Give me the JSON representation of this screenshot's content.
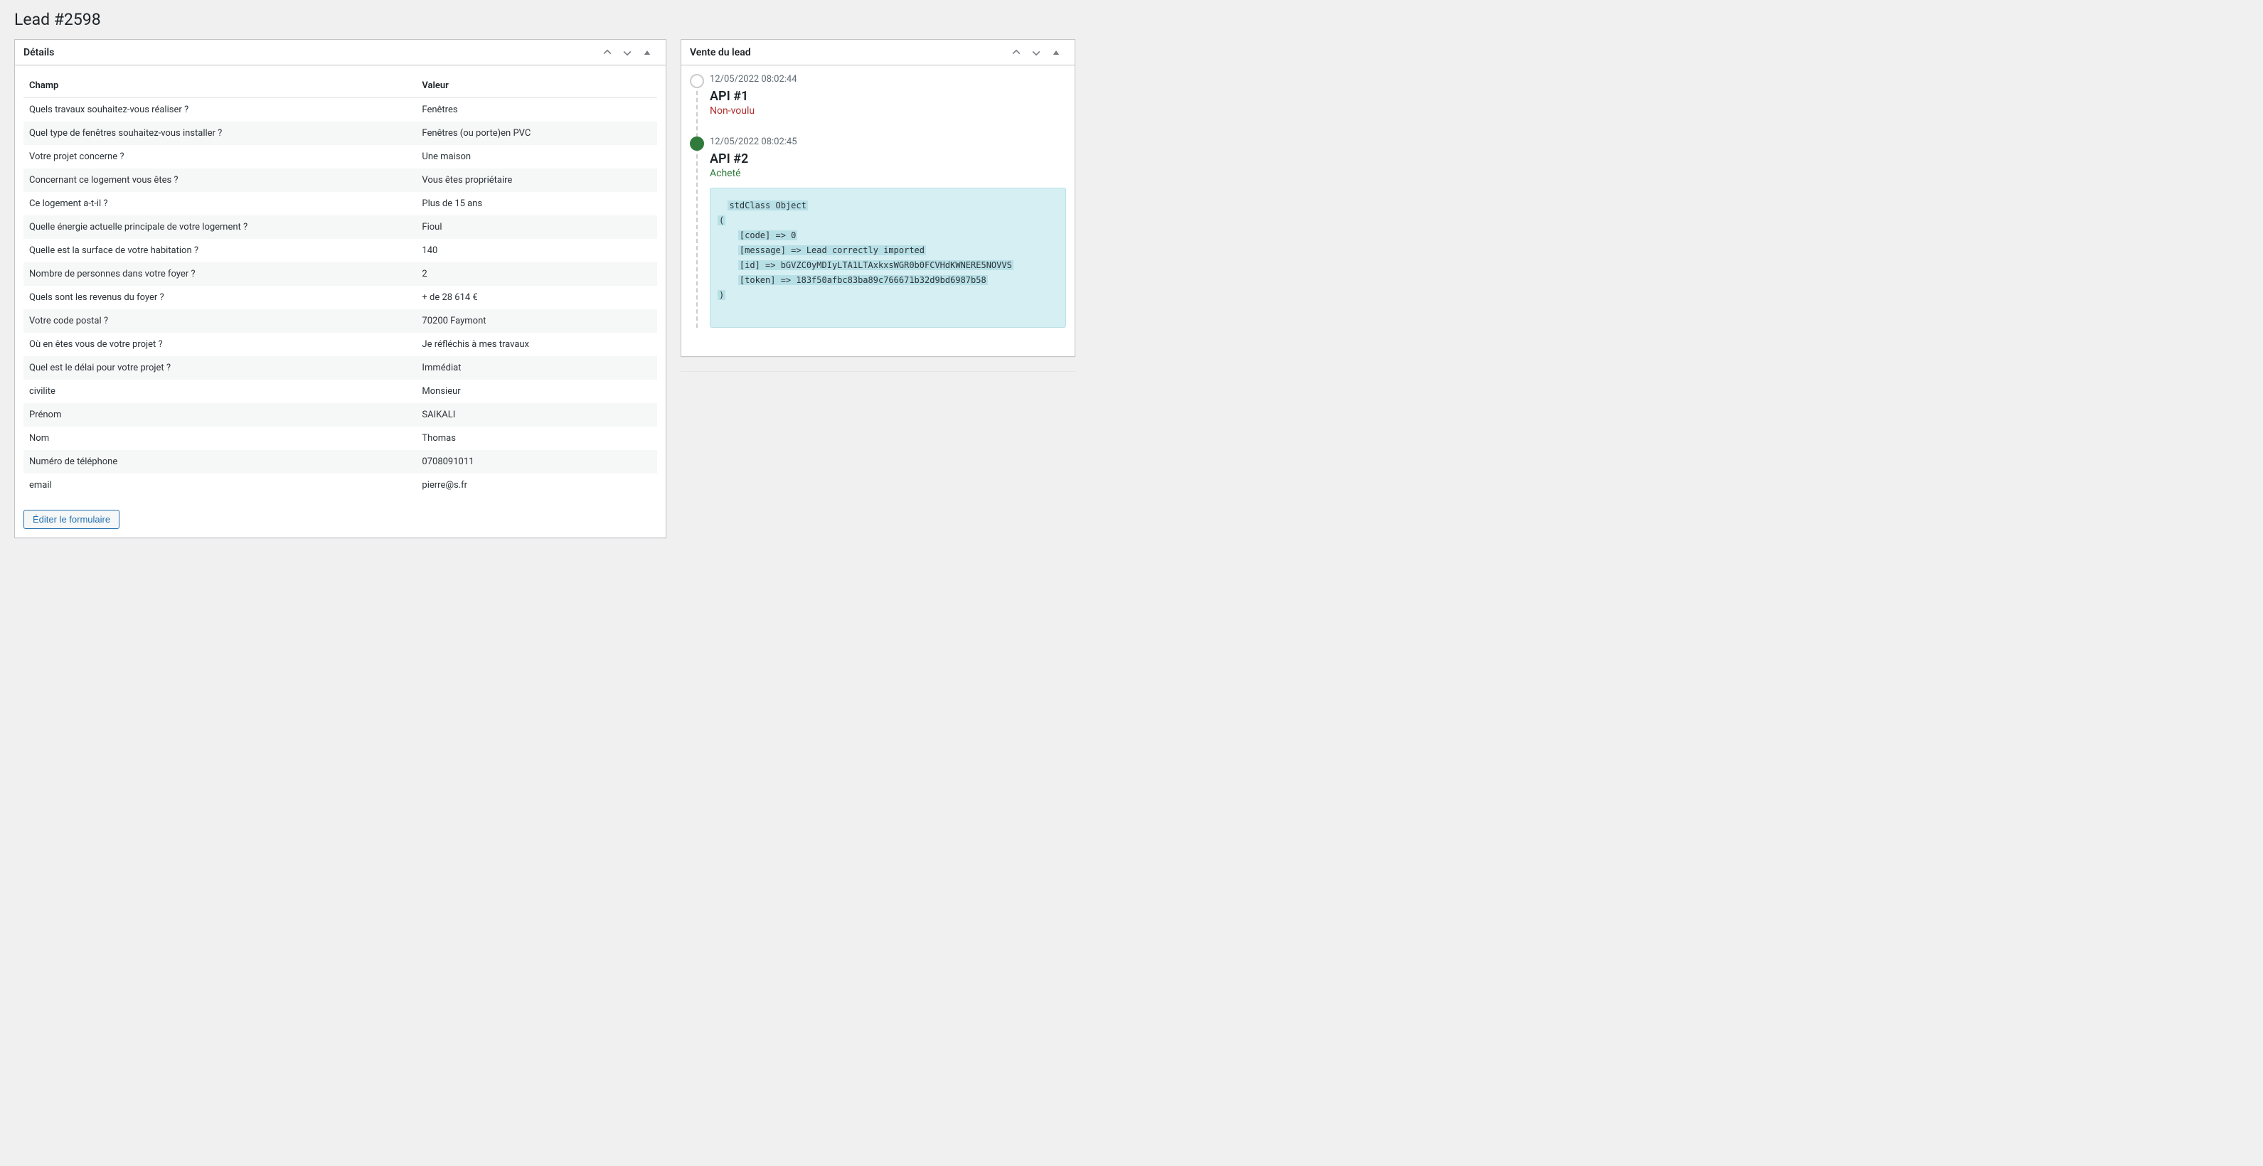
{
  "page": {
    "title": "Lead #2598"
  },
  "details_panel": {
    "title": "Détails",
    "header_field": "Champ",
    "header_value": "Valeur",
    "edit_button": "Éditer le formulaire",
    "rows": [
      {
        "field": "Quels travaux souhaitez-vous réaliser ?",
        "value": "Fenêtres"
      },
      {
        "field": "Quel type de fenêtres souhaitez-vous installer ?",
        "value": "Fenêtres (ou porte)en PVC"
      },
      {
        "field": "Votre projet concerne ?",
        "value": "Une maison"
      },
      {
        "field": "Concernant ce logement vous êtes ?",
        "value": "Vous êtes propriétaire"
      },
      {
        "field": "Ce logement a-t-il ?",
        "value": "Plus de 15 ans"
      },
      {
        "field": "Quelle énergie actuelle principale de votre logement ?",
        "value": "Fioul"
      },
      {
        "field": "Quelle est la surface de votre habitation ?",
        "value": "140"
      },
      {
        "field": "Nombre de personnes dans votre foyer ?",
        "value": "2"
      },
      {
        "field": "Quels sont les revenus du foyer ?",
        "value": "+ de 28 614 €"
      },
      {
        "field": "Votre code postal ?",
        "value": "70200 Faymont"
      },
      {
        "field": "Où en êtes vous de votre projet ?",
        "value": "Je réfléchis à mes travaux"
      },
      {
        "field": "Quel est le délai pour votre projet ?",
        "value": "Immédiat"
      },
      {
        "field": "civilite",
        "value": "Monsieur"
      },
      {
        "field": "Prénom",
        "value": "SAIKALI"
      },
      {
        "field": "Nom",
        "value": "Thomas"
      },
      {
        "field": "Numéro de téléphone",
        "value": "0708091011"
      },
      {
        "field": "email",
        "value": "pierre@s.fr"
      }
    ]
  },
  "sale_panel": {
    "title": "Vente du lead",
    "events": [
      {
        "date": "12/05/2022 08:02:44",
        "title": "API #1",
        "status": "Non-voulu",
        "status_kind": "unwanted",
        "dot": "empty"
      },
      {
        "date": "12/05/2022 08:02:45",
        "title": "API #2",
        "status": "Acheté",
        "status_kind": "bought",
        "dot": "filled",
        "dump": {
          "header": "stdClass Object",
          "open": "(",
          "lines": [
            "[code] => 0",
            "[message] => Lead correctly imported",
            "[id] => bGVZC0yMDIyLTA1LTAxkxsWGR0b0FCVHdKWNERE5NOVVS",
            "[token] => 183f50afbc83ba89c766671b32d9bd6987b58"
          ],
          "close": ")"
        }
      }
    ]
  }
}
